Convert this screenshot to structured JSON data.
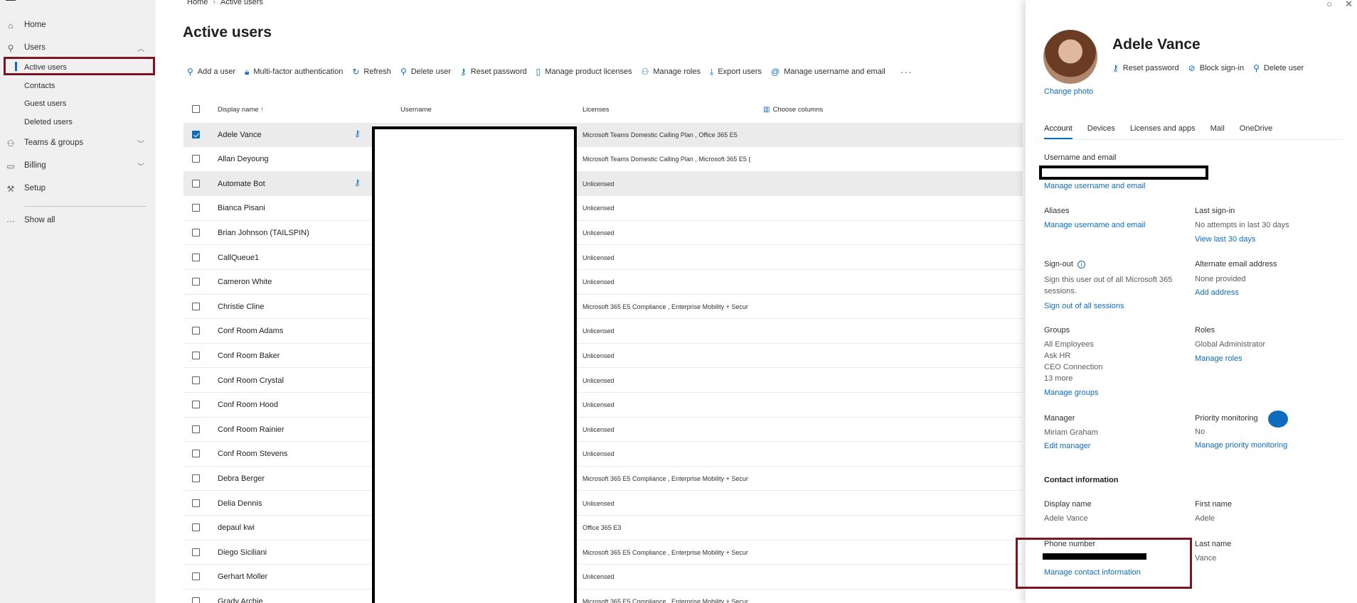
{
  "sidebar": {
    "items": [
      {
        "label": "Home",
        "icon": "home-icon"
      },
      {
        "label": "Users",
        "icon": "person-icon"
      },
      {
        "label": "Teams & groups",
        "icon": "teams-icon"
      },
      {
        "label": "Billing",
        "icon": "billing-icon"
      },
      {
        "label": "Setup",
        "icon": "wrench-icon"
      },
      {
        "label": "Show all",
        "icon": "more-icon"
      }
    ],
    "users_sub": [
      "Active users",
      "Contacts",
      "Guest users",
      "Deleted users"
    ]
  },
  "breadcrumb": {
    "home": "Home",
    "current": "Active users"
  },
  "page": {
    "title": "Active users"
  },
  "toolbar": {
    "add_user": "Add a user",
    "mfa": "Multi-factor authentication",
    "refresh": "Refresh",
    "delete_user": "Delete user",
    "reset_password": "Reset password",
    "manage_licenses": "Manage product licenses",
    "manage_roles": "Manage roles",
    "export_users": "Export users",
    "manage_username": "Manage username and email",
    "more": "···"
  },
  "table": {
    "headers": {
      "display_name": "Display name",
      "sort_arrow": "↑",
      "username": "Username",
      "licenses": "Licenses",
      "choose_columns": "Choose columns"
    },
    "rows": [
      {
        "name": "Adele Vance",
        "licenses": "Microsoft Teams Domestic Calling Plan , Office 365 E5"
      },
      {
        "name": "Allan Deyoung",
        "licenses": "Microsoft Teams Domestic Calling Plan , Microsoft 365 E5 ("
      },
      {
        "name": "Automate Bot",
        "licenses": "Unlicensed"
      },
      {
        "name": "Bianca Pisani",
        "licenses": "Unlicensed"
      },
      {
        "name": "Brian Johnson (TAILSPIN)",
        "licenses": "Unlicensed"
      },
      {
        "name": "CallQueue1",
        "licenses": "Unlicensed"
      },
      {
        "name": "Cameron White",
        "licenses": "Unlicensed"
      },
      {
        "name": "Christie Cline",
        "licenses": "Microsoft 365 E5 Compliance , Enterprise Mobility + Secur"
      },
      {
        "name": "Conf Room Adams",
        "licenses": "Unlicensed"
      },
      {
        "name": "Conf Room Baker",
        "licenses": "Unlicensed"
      },
      {
        "name": "Conf Room Crystal",
        "licenses": "Unlicensed"
      },
      {
        "name": "Conf Room Hood",
        "licenses": "Unlicensed"
      },
      {
        "name": "Conf Room Rainier",
        "licenses": "Unlicensed"
      },
      {
        "name": "Conf Room Stevens",
        "licenses": "Unlicensed"
      },
      {
        "name": "Debra Berger",
        "licenses": "Microsoft 365 E5 Compliance , Enterprise Mobility + Secur"
      },
      {
        "name": "Delia Dennis",
        "licenses": "Unlicensed"
      },
      {
        "name": "depaul kwi",
        "licenses": "Office 365 E3"
      },
      {
        "name": "Diego Siciliani",
        "licenses": "Microsoft 365 E5 Compliance , Enterprise Mobility + Secur"
      },
      {
        "name": "Gerhart Moller",
        "licenses": "Unlicensed"
      },
      {
        "name": "Grady Archie",
        "licenses": "Microsoft 365 E5 Compliance , Enterprise Mobility + Secur"
      }
    ]
  },
  "panel": {
    "user_name": "Adele Vance",
    "change_photo": "Change photo",
    "actions": {
      "reset_password": "Reset password",
      "block_signin": "Block sign-in",
      "delete_user": "Delete user"
    },
    "tabs": [
      "Account",
      "Devices",
      "Licenses and apps",
      "Mail",
      "OneDrive"
    ],
    "username_email": {
      "label": "Username and email",
      "link": "Manage username and email"
    },
    "aliases": {
      "label": "Aliases",
      "link": "Manage username and email"
    },
    "last_signin": {
      "label": "Last sign-in",
      "value": "No attempts in last 30 days",
      "link": "View last 30 days"
    },
    "signout": {
      "label": "Sign-out",
      "value": "Sign this user out of all Microsoft 365 sessions.",
      "link": "Sign out of all sessions"
    },
    "alt_email": {
      "label": "Alternate email address",
      "value": "None provided",
      "link": "Add address"
    },
    "groups": {
      "label": "Groups",
      "values": [
        "All Employees",
        "Ask HR",
        "CEO Connection",
        "13 more"
      ],
      "link": "Manage groups"
    },
    "roles": {
      "label": "Roles",
      "value": "Global Administrator",
      "link": "Manage roles"
    },
    "manager": {
      "label": "Manager",
      "value": "Miriam Graham",
      "link": "Edit manager"
    },
    "priority": {
      "label": "Priority monitoring",
      "value": "No",
      "link": "Manage priority monitoring"
    },
    "contact_section": "Contact information",
    "display_name": {
      "label": "Display name",
      "value": "Adele Vance"
    },
    "first_name": {
      "label": "First name",
      "value": "Adele"
    },
    "phone": {
      "label": "Phone number",
      "link": "Manage contact information"
    },
    "last_name": {
      "label": "Last name",
      "value": "Vance"
    }
  }
}
